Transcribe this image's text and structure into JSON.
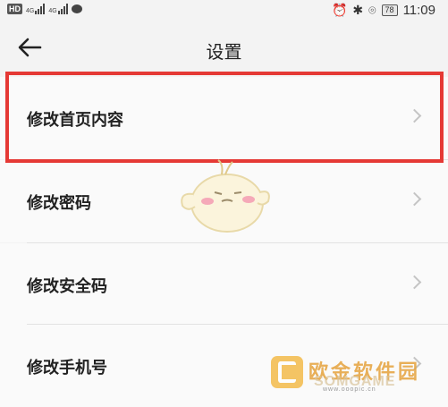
{
  "status_bar": {
    "hd_label": "HD",
    "network_1": "4G",
    "network_2": "4G",
    "battery": "78",
    "time": "11:09",
    "icons": [
      "hd-icon",
      "signal-icon",
      "chat-icon",
      "alarm-icon",
      "bluetooth-icon",
      "location-icon",
      "battery-icon"
    ]
  },
  "header": {
    "title": "设置",
    "back_icon": "arrow-left-icon"
  },
  "settings_items": [
    {
      "label": "修改首页内容",
      "highlighted": true
    },
    {
      "label": "修改密码"
    },
    {
      "label": "修改安全码"
    },
    {
      "label": "修改手机号"
    }
  ],
  "highlight_color": "#e53935",
  "watermark": {
    "name": "欧金软件园",
    "english": "SOMGAME",
    "url": "www.ooopic.cn"
  }
}
